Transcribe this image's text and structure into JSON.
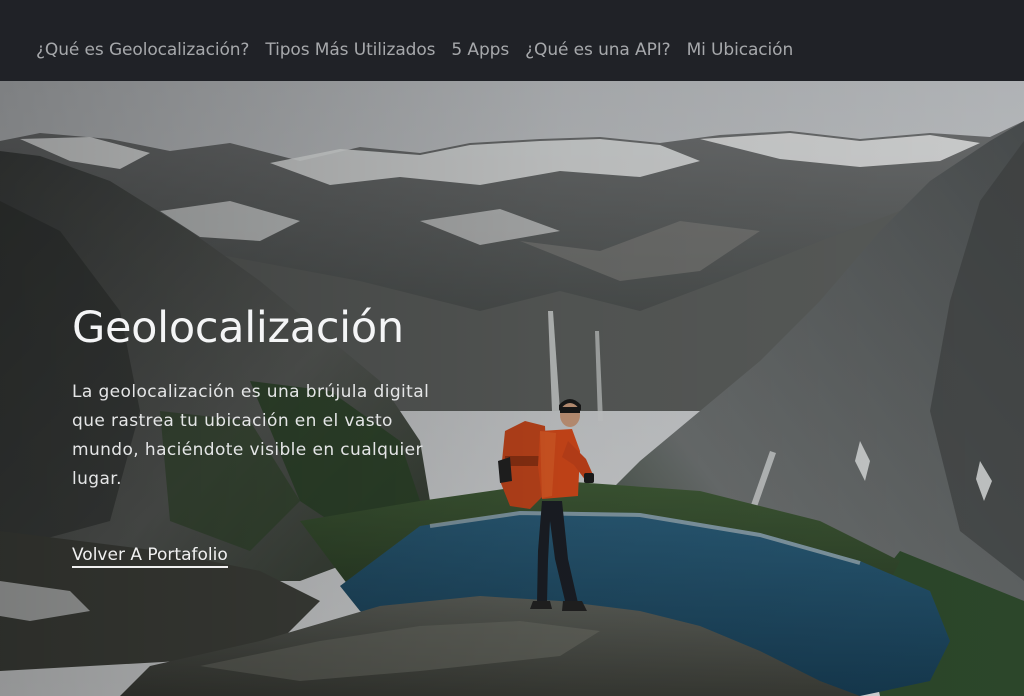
{
  "nav": {
    "items": [
      {
        "label": "¿Qué es Geolocalización?"
      },
      {
        "label": "Tipos Más Utilizados"
      },
      {
        "label": "5 Apps"
      },
      {
        "label": "¿Qué es una API?"
      },
      {
        "label": "Mi Ubicación"
      }
    ]
  },
  "hero": {
    "title": "Geolocalización",
    "description": "La geolocalización es una brújula digital que rastrea tu ubicación en el vasto mundo, haciéndote visible en cualquier lugar.",
    "link_label": "Volver A Portafolio",
    "image_icon": "mountain-lake-hiker-photo"
  },
  "colors": {
    "nav_bg": "#202227",
    "nav_text": "#a6a8ab",
    "hero_text": "#f4f5f6",
    "lake": "#1f4a63"
  }
}
